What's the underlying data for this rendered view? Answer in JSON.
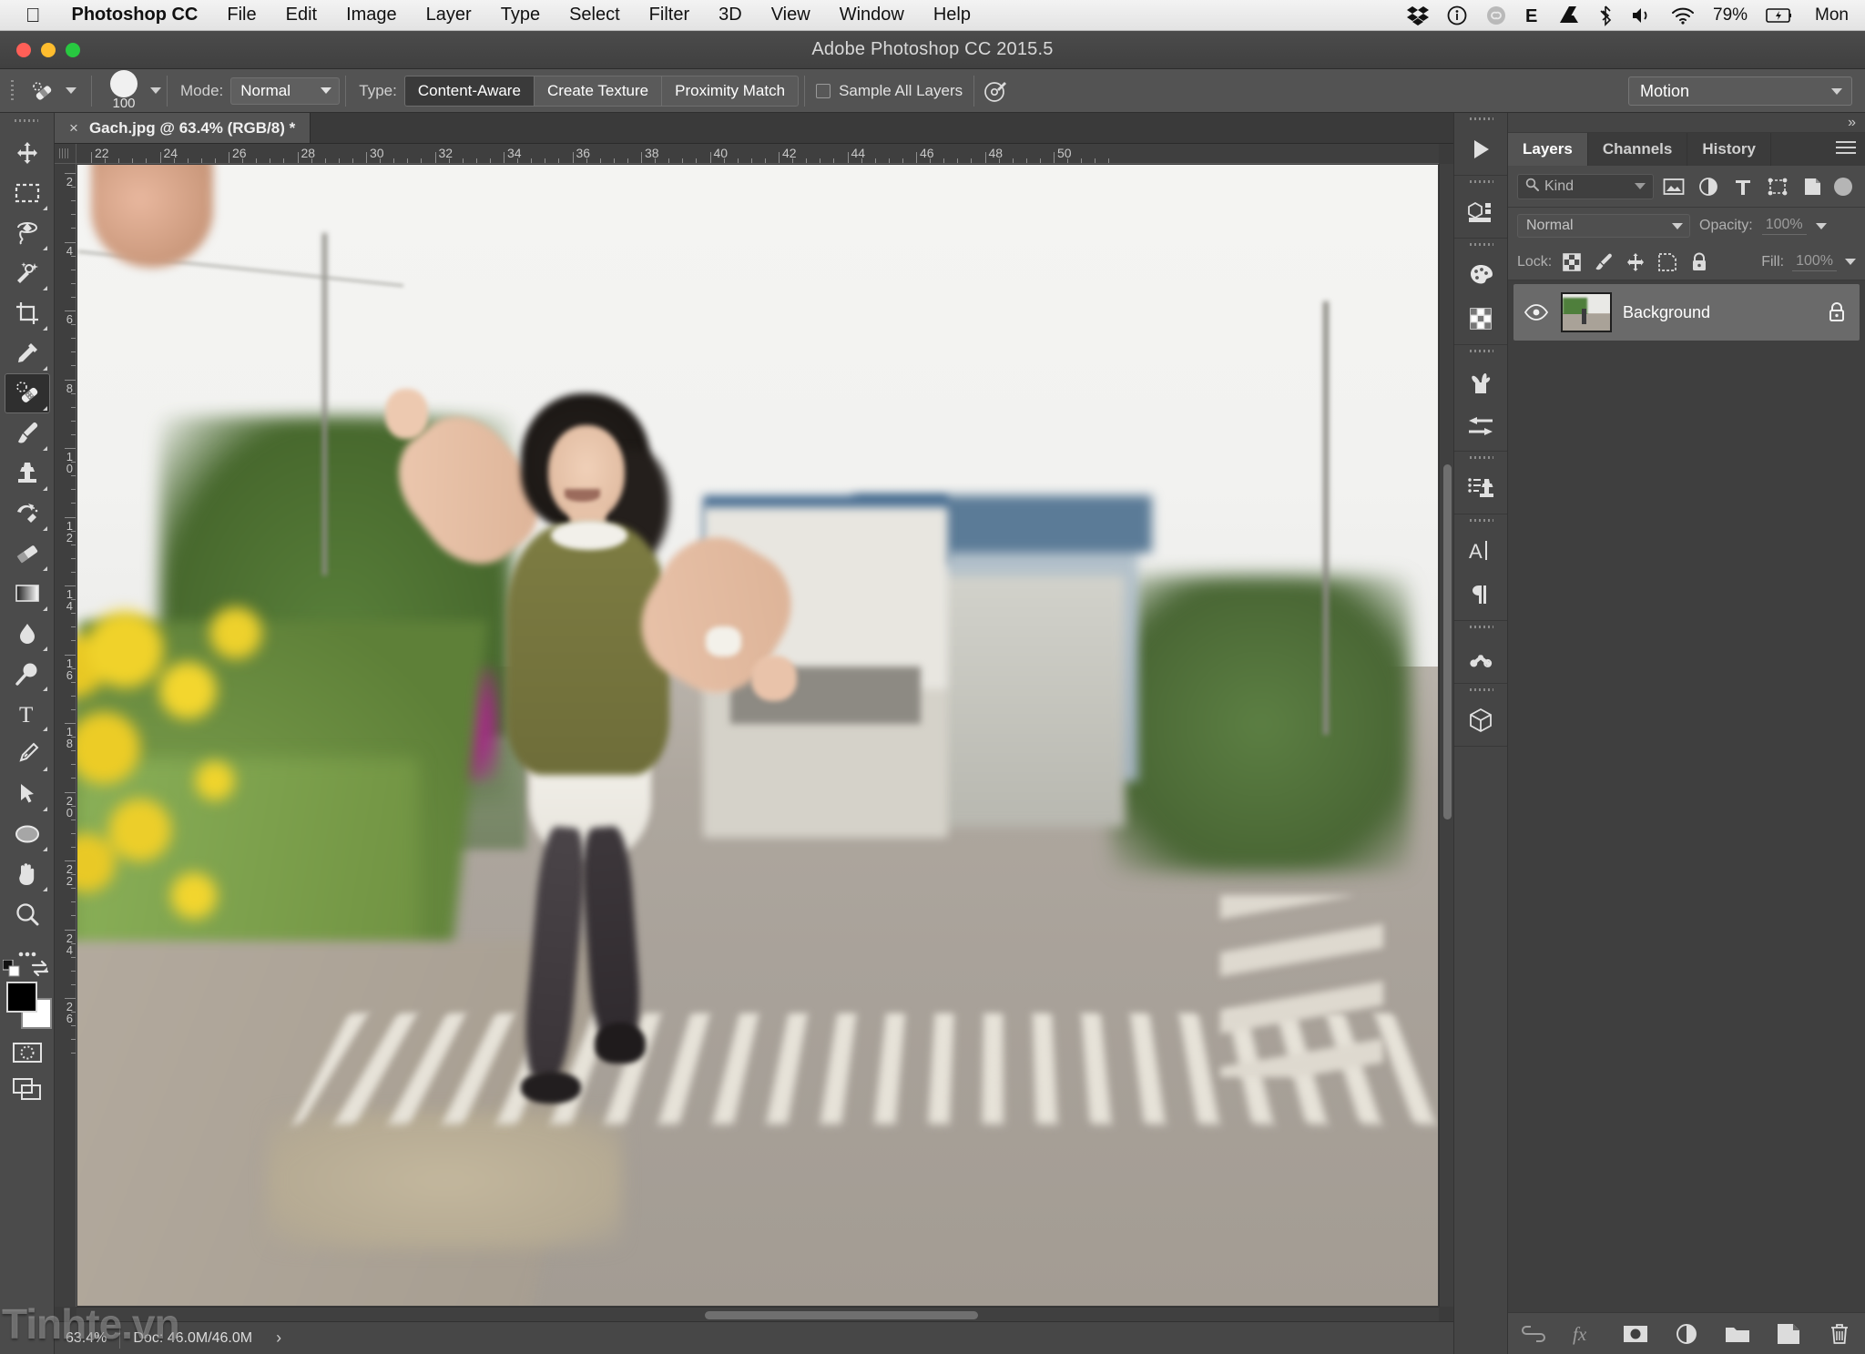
{
  "macbar": {
    "apple_icon": "apple-logo-icon",
    "app_name": "Photoshop CC",
    "menus": [
      "File",
      "Edit",
      "Image",
      "Layer",
      "Type",
      "Select",
      "Filter",
      "3D",
      "View",
      "Window",
      "Help"
    ],
    "status_icons": [
      "dropbox-icon",
      "info-circle-icon",
      "creative-cloud-icon",
      "evernote-icon",
      "google-drive-icon",
      "bluetooth-icon",
      "volume-icon",
      "wifi-icon"
    ],
    "battery_percent": "79%",
    "battery_icon": "battery-charging-icon",
    "day": "Mon"
  },
  "window": {
    "title": "Adobe Photoshop CC 2015.5",
    "traffic_lights": [
      "close",
      "minimize",
      "zoom"
    ]
  },
  "options_bar": {
    "tool_icon": "spot-healing-brush-icon",
    "brush_size": "100",
    "mode_label": "Mode:",
    "mode_value": "Normal",
    "type_label": "Type:",
    "type_options": [
      "Content-Aware",
      "Create Texture",
      "Proximity Match"
    ],
    "type_selected": "Content-Aware",
    "sample_all_layers_label": "Sample All Layers",
    "sample_all_layers_checked": false,
    "airbrush_icon": "pressure-airbrush-icon",
    "workspace_value": "Motion"
  },
  "toolbar": {
    "tools": [
      {
        "name": "move-tool",
        "selected": false
      },
      {
        "name": "rectangular-marquee-tool",
        "selected": false
      },
      {
        "name": "lasso-tool",
        "selected": false
      },
      {
        "name": "quick-selection-tool",
        "selected": false
      },
      {
        "name": "crop-tool",
        "selected": false
      },
      {
        "name": "eyedropper-tool",
        "selected": false
      },
      {
        "name": "spot-healing-brush-tool",
        "selected": true
      },
      {
        "name": "brush-tool",
        "selected": false
      },
      {
        "name": "clone-stamp-tool",
        "selected": false
      },
      {
        "name": "history-brush-tool",
        "selected": false
      },
      {
        "name": "eraser-tool",
        "selected": false
      },
      {
        "name": "gradient-tool",
        "selected": false
      },
      {
        "name": "blur-tool",
        "selected": false
      },
      {
        "name": "dodge-tool",
        "selected": false
      },
      {
        "name": "type-tool",
        "selected": false
      },
      {
        "name": "pen-tool",
        "selected": false
      },
      {
        "name": "path-selection-tool",
        "selected": false
      },
      {
        "name": "ellipse-shape-tool",
        "selected": false
      },
      {
        "name": "hand-tool",
        "selected": false
      },
      {
        "name": "zoom-tool",
        "selected": false
      },
      {
        "name": "edit-toolbar-tool",
        "selected": false
      }
    ],
    "foreground_color": "#000000",
    "background_color": "#ffffff",
    "quick_mask_icon": "quick-mask-icon",
    "screen_mode_icon": "screen-mode-icon"
  },
  "document": {
    "tab_label": "Gach.jpg @ 63.4% (RGB/8) *",
    "close_glyph": "×",
    "ruler_h_labels": [
      "22",
      "24",
      "26",
      "28",
      "30",
      "32",
      "34",
      "36",
      "38",
      "40",
      "42",
      "44",
      "46",
      "48",
      "50"
    ],
    "ruler_v_labels": [
      "2",
      "4",
      "6",
      "8",
      "10",
      "12",
      "14",
      "16",
      "18",
      "20",
      "22",
      "24",
      "26"
    ],
    "ruler_units": "cm"
  },
  "status_bar": {
    "zoom": "63.4%",
    "doc_info": "Doc: 46.0M/46.0M",
    "expand_glyph": "›"
  },
  "watermark": "Tinhte.vn",
  "dock_rail": {
    "groups": [
      [
        "play-actions-icon"
      ],
      [
        "3d-panel-icon"
      ],
      [
        "color-palette-icon",
        "swatches-grid-icon"
      ],
      [
        "brushes-icon",
        "brush-settings-icon"
      ],
      [
        "clone-source-icon"
      ],
      [
        "character-panel-icon",
        "paragraph-panel-icon"
      ],
      [
        "tool-presets-icon"
      ],
      [
        "3d-cube-icon"
      ]
    ]
  },
  "layers_panel": {
    "collapse_glyph": "»",
    "tabs": [
      {
        "label": "Layers",
        "active": true
      },
      {
        "label": "Channels",
        "active": false
      },
      {
        "label": "History",
        "active": false
      }
    ],
    "menu_icon": "panel-menu-icon",
    "filter": {
      "search_icon": "search-icon",
      "kind_label": "Kind",
      "filter_icons": [
        "pixel-layers-filter-icon",
        "adjustment-layers-filter-icon",
        "type-layers-filter-icon",
        "shape-layers-filter-icon",
        "smart-object-filter-icon"
      ],
      "toggle_on": true
    },
    "blend_mode": "Normal",
    "opacity_label": "Opacity:",
    "opacity_value": "100%",
    "lock_label": "Lock:",
    "lock_icons": [
      "lock-transparent-pixels-icon",
      "lock-image-pixels-icon",
      "lock-position-icon",
      "lock-artboard-icon",
      "lock-all-icon"
    ],
    "fill_label": "Fill:",
    "fill_value": "100%",
    "layers": [
      {
        "name": "Background",
        "visible": true,
        "locked": true,
        "visibility_icon": "eye-icon",
        "lock_icon": "lock-icon",
        "selected": true
      }
    ],
    "bottom_buttons": [
      "link-layers-icon",
      "layer-style-fx-icon",
      "add-layer-mask-icon",
      "new-adjustment-layer-icon",
      "new-group-icon",
      "new-layer-icon",
      "delete-layer-icon"
    ]
  }
}
